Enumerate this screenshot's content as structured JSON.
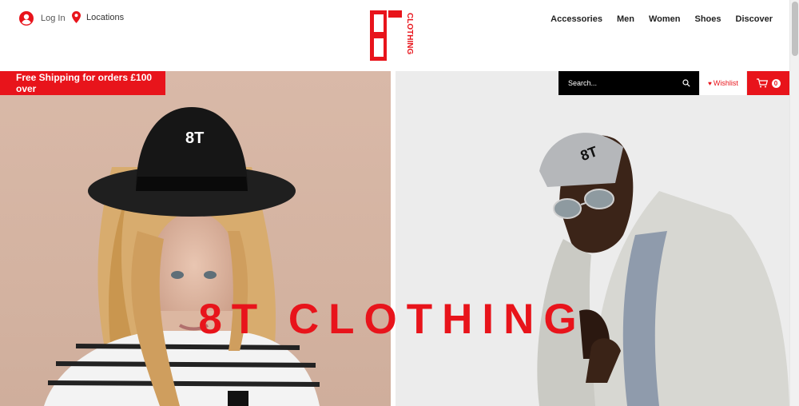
{
  "header": {
    "login_label": "Log In",
    "locations_label": "Locations",
    "logo_text": "8T",
    "logo_subtext": "CLOTHING",
    "nav": [
      "Accessories",
      "Men",
      "Women",
      "Shoes",
      "Discover"
    ]
  },
  "promo": {
    "shipping": "Free Shipping for orders £100 over"
  },
  "search": {
    "placeholder": "Search..."
  },
  "wishlist": {
    "label": "Wishlist"
  },
  "cart": {
    "count": "0"
  },
  "hero": {
    "title": "8T CLOTHING"
  },
  "colors": {
    "accent": "#e8141b",
    "search_bg": "#000000",
    "left_bg": "#d9b9a8",
    "right_bg": "#ececec"
  },
  "icons": {
    "login": "user-circle-icon",
    "locations": "map-pin-icon",
    "search": "search-icon",
    "wishlist": "heart-icon",
    "cart": "shopping-cart-icon"
  }
}
